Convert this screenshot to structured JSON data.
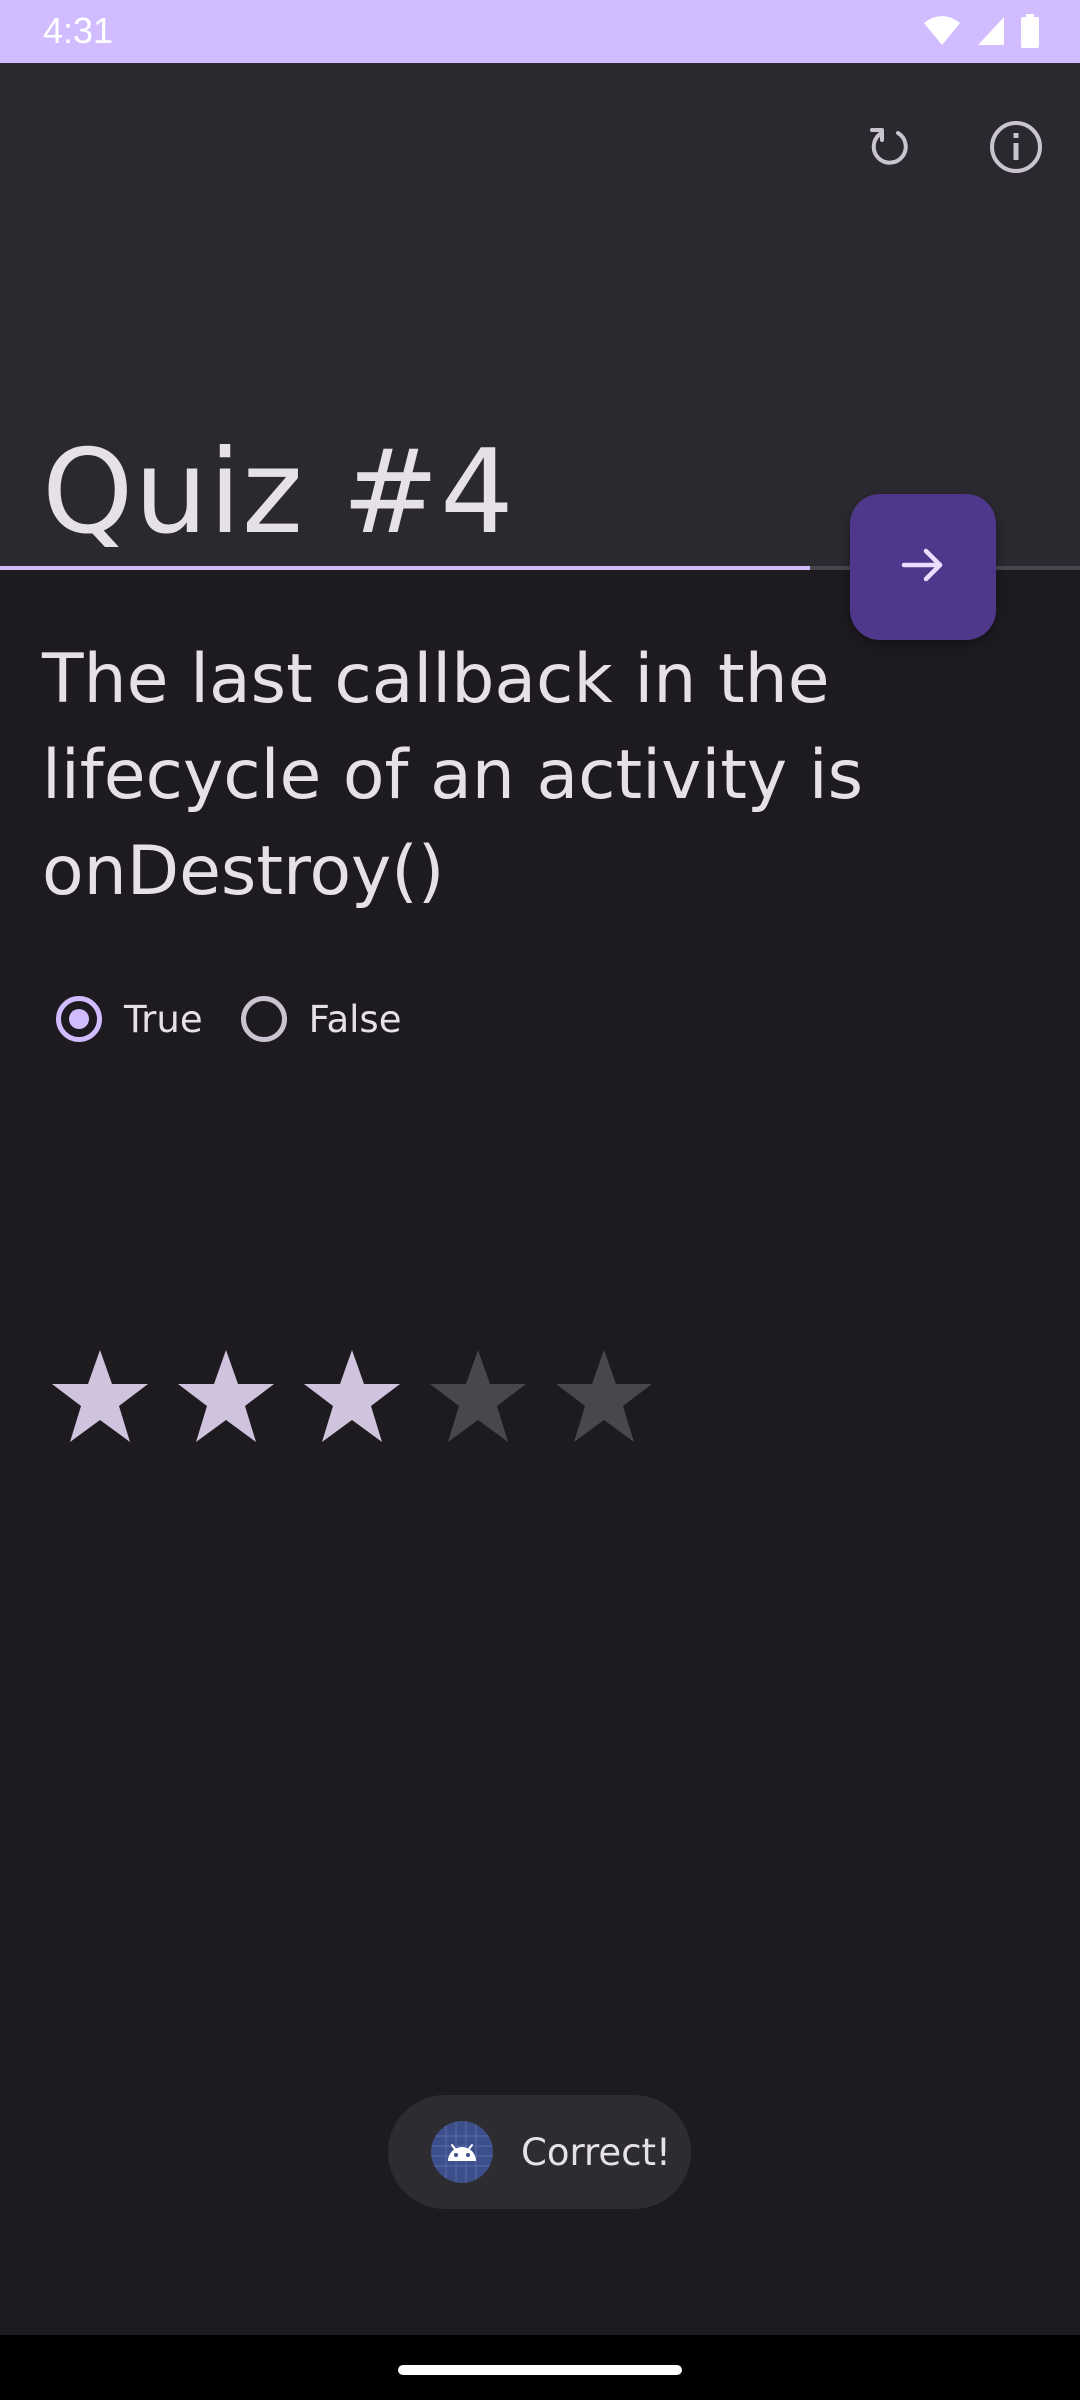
{
  "status_bar": {
    "time": "4:31",
    "icons": [
      "wifi-icon",
      "signal-icon",
      "battery-icon"
    ],
    "color": "#d0bcff"
  },
  "app_bar": {
    "title": "Quiz #4",
    "actions": [
      "reset-icon",
      "info-icon"
    ],
    "background": "#2b2930"
  },
  "progress": {
    "fraction": 0.75
  },
  "fab": {
    "icon": "arrow-forward-icon",
    "color": "#4f378b"
  },
  "question": {
    "text": "The last callback in the lifecycle of an activity is onDestroy()"
  },
  "answers": {
    "options": [
      {
        "label": "True",
        "checked": true
      },
      {
        "label": "False",
        "checked": false
      }
    ]
  },
  "rating": {
    "value": 3,
    "max": 5,
    "filled_color": "#d0c3dd",
    "empty_color": "#49474d"
  },
  "toast": {
    "icon": "android-icon",
    "text": "Correct!"
  }
}
